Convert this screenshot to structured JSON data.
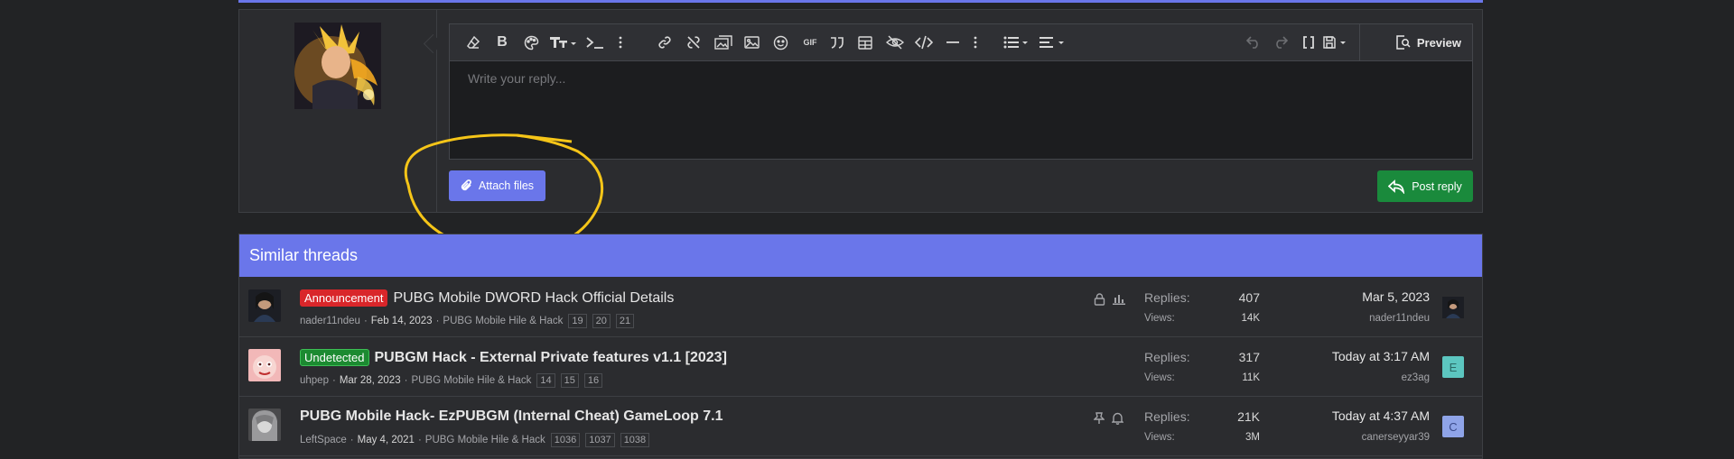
{
  "colors": {
    "accent": "#6a76ea",
    "post": "#1a8a3c",
    "announcement": "#d9262a",
    "undetected": "#1c8a31",
    "highlight": "#f5c518"
  },
  "toolbar": {
    "icons": [
      "eraser-icon",
      "bold-icon",
      "palette-icon",
      "font-size-icon",
      "code-inline-icon",
      "more-vertical-icon",
      "link-icon",
      "unlink-icon",
      "gallery-icon",
      "image-icon",
      "emoji-icon",
      "gif-icon",
      "quote-icon",
      "table-icon",
      "spoiler-icon",
      "code-icon",
      "horizontal-line-icon",
      "more-vertical-icon",
      "list-icon",
      "align-icon",
      "undo-icon",
      "redo-icon",
      "bbcode-icon",
      "drafts-icon"
    ],
    "gif_label": "GIF",
    "preview_label": "Preview"
  },
  "editor": {
    "placeholder": "Write your reply..."
  },
  "actions": {
    "attach_label": "Attach files",
    "post_label": "Post reply"
  },
  "similar": {
    "heading": "Similar threads",
    "replies_label": "Replies:",
    "views_label": "Views:",
    "threads": [
      {
        "label": "Announcement",
        "title": "PUBG Mobile DWORD Hack Official Details",
        "author": "nader11ndeu",
        "date": "Feb 14, 2023",
        "forum": "PUBG Mobile Hile & Hack",
        "pages": [
          "19",
          "20",
          "21"
        ],
        "replies": "407",
        "views": "14K",
        "last_date": "Mar 5, 2023",
        "last_user": "nader11ndeu",
        "icons": [
          "lock-icon",
          "poll-icon"
        ]
      },
      {
        "label": "Undetected",
        "title": "PUBGM Hack - External Private features v1.1 [2023]",
        "author": "uhpep",
        "date": "Mar 28, 2023",
        "forum": "PUBG Mobile Hile & Hack",
        "pages": [
          "14",
          "15",
          "16"
        ],
        "replies": "317",
        "views": "11K",
        "last_date": "Today at 3:17 AM",
        "last_user": "ez3ag",
        "last_avatar_letter": "E"
      },
      {
        "label": "",
        "title": "PUBG Mobile Hack- EzPUBGM (Internal Cheat) GameLoop 7.1",
        "author": "LeftSpace",
        "date": "May 4, 2021",
        "forum": "PUBG Mobile Hile & Hack",
        "pages": [
          "1036",
          "1037",
          "1038"
        ],
        "replies": "21K",
        "views": "3M",
        "last_date": "Today at 4:37 AM",
        "last_user": "canerseyyar39",
        "last_avatar_letter": "C",
        "icons": [
          "pin-icon",
          "bell-icon"
        ]
      }
    ]
  }
}
